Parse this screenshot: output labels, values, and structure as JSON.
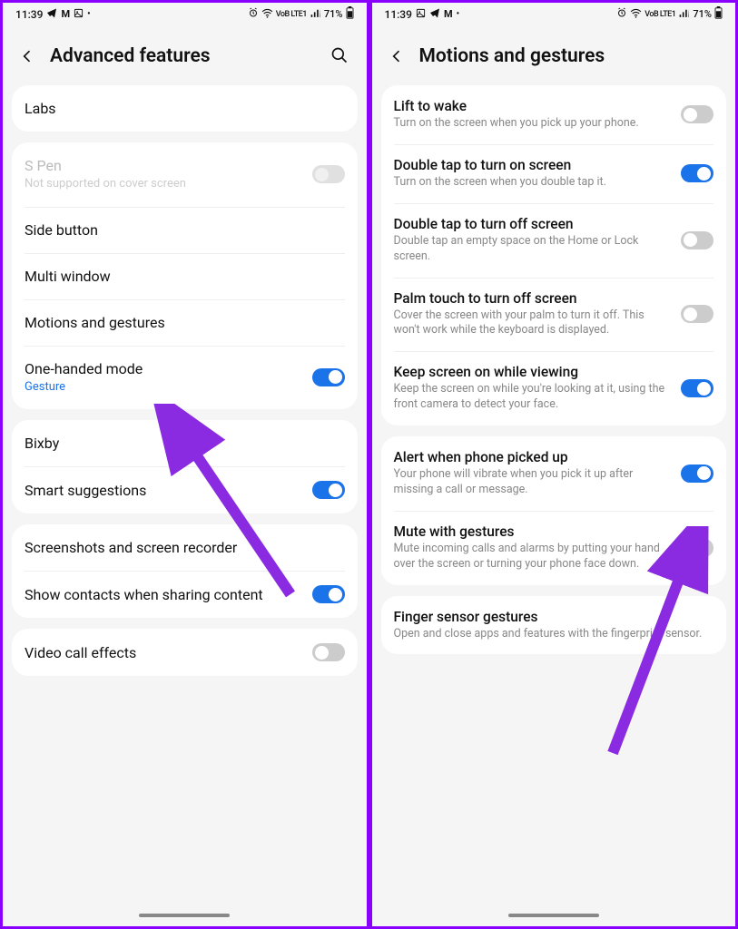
{
  "status": {
    "time": "11:39",
    "battery": "71%",
    "network_label": "VoB LTE1"
  },
  "left": {
    "title": "Advanced features",
    "groups": [
      [
        {
          "title": "Labs"
        }
      ],
      [
        {
          "title": "S Pen",
          "sub": "Not supported on cover screen",
          "disabled": true,
          "toggle": "disabled"
        },
        {
          "title": "Side button"
        },
        {
          "title": "Multi window"
        },
        {
          "title": "Motions and gestures"
        },
        {
          "title": "One-handed mode",
          "sub": "Gesture",
          "sub_blue": true,
          "toggle": "on"
        }
      ],
      [
        {
          "title": "Bixby"
        },
        {
          "title": "Smart suggestions",
          "toggle": "on"
        }
      ],
      [
        {
          "title": "Screenshots and screen recorder"
        },
        {
          "title": "Show contacts when sharing content",
          "toggle": "on"
        }
      ],
      [
        {
          "title": "Video call effects",
          "toggle": "off"
        }
      ]
    ]
  },
  "right": {
    "title": "Motions and gestures",
    "groups": [
      [
        {
          "title": "Lift to wake",
          "sub": "Turn on the screen when you pick up your phone.",
          "toggle": "off"
        },
        {
          "title": "Double tap to turn on screen",
          "sub": "Turn on the screen when you double tap it.",
          "toggle": "on"
        },
        {
          "title": "Double tap to turn off screen",
          "sub": "Double tap an empty space on the Home or Lock screen.",
          "toggle": "off"
        },
        {
          "title": "Palm touch to turn off screen",
          "sub": "Cover the screen with your palm to turn it off. This won't work while the keyboard is displayed.",
          "toggle": "off"
        },
        {
          "title": "Keep screen on while viewing",
          "sub": "Keep the screen on while you're looking at it, using the front camera to detect your face.",
          "toggle": "on"
        }
      ],
      [
        {
          "title": "Alert when phone picked up",
          "sub": "Your phone will vibrate when you pick it up after missing a call or message.",
          "toggle": "on"
        },
        {
          "title": "Mute with gestures",
          "sub": "Mute incoming calls and alarms by putting your hand over the screen or turning your phone face down.",
          "toggle": "off"
        }
      ],
      [
        {
          "title": "Finger sensor gestures",
          "sub": "Open and close apps and features with the fingerprint sensor."
        }
      ]
    ]
  }
}
